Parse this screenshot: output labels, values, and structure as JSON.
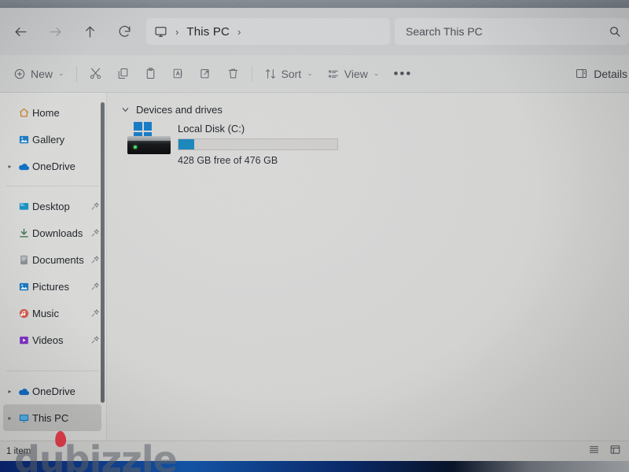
{
  "window": {
    "title": "This PC"
  },
  "nav": {
    "back_icon": "arrow-left-icon",
    "forward_icon": "arrow-right-icon",
    "up_icon": "arrow-up-icon",
    "refresh_icon": "refresh-icon"
  },
  "address": {
    "root_icon": "this-pc-monitor-icon",
    "separator": "›",
    "crumb": "This PC",
    "trailing_separator": "›"
  },
  "search": {
    "placeholder": "Search This PC",
    "icon": "search-icon"
  },
  "toolbar": {
    "new_label": "New",
    "new_icon": "plus-circle-icon",
    "new_chevron": "⌄",
    "cut_icon": "scissors-icon",
    "copy_icon": "copy-icon",
    "paste_icon": "clipboard-paste-icon",
    "rename_icon": "rename-icon",
    "share_icon": "share-icon",
    "delete_icon": "trash-icon",
    "sort_label": "Sort",
    "sort_icon": "sort-arrows-icon",
    "sort_chevron": "⌄",
    "view_label": "View",
    "view_icon": "view-list-icon",
    "view_chevron": "⌄",
    "more_label": "•••",
    "details_label": "Details",
    "details_icon": "details-pane-icon"
  },
  "sidebar": {
    "groups": [
      {
        "items": [
          {
            "label": "Home",
            "icon": "home-icon",
            "pinned": false,
            "chevron": false,
            "selected": false
          },
          {
            "label": "Gallery",
            "icon": "gallery-icon",
            "pinned": false,
            "chevron": false,
            "selected": false
          },
          {
            "label": "OneDrive",
            "icon": "onedrive-icon",
            "pinned": false,
            "chevron": true,
            "selected": false
          }
        ]
      },
      {
        "items": [
          {
            "label": "Desktop",
            "icon": "desktop-icon",
            "pinned": true,
            "chevron": false,
            "selected": false
          },
          {
            "label": "Downloads",
            "icon": "downloads-icon",
            "pinned": true,
            "chevron": false,
            "selected": false
          },
          {
            "label": "Documents",
            "icon": "documents-icon",
            "pinned": true,
            "chevron": false,
            "selected": false
          },
          {
            "label": "Pictures",
            "icon": "pictures-icon",
            "pinned": true,
            "chevron": false,
            "selected": false
          },
          {
            "label": "Music",
            "icon": "music-icon",
            "pinned": true,
            "chevron": false,
            "selected": false
          },
          {
            "label": "Videos",
            "icon": "videos-icon",
            "pinned": true,
            "chevron": false,
            "selected": false
          }
        ]
      },
      {
        "items": [
          {
            "label": "OneDrive",
            "icon": "onedrive-icon",
            "pinned": false,
            "chevron": true,
            "selected": false
          },
          {
            "label": "This PC",
            "icon": "this-pc-icon",
            "pinned": false,
            "chevron": true,
            "selected": true
          }
        ]
      }
    ],
    "pin_icon": "pin-icon",
    "scrollbar": "sidebar-scrollbar"
  },
  "content": {
    "group_title": "Devices and drives",
    "group_chevron": "⌄",
    "drives": [
      {
        "name": "Local Disk (C:)",
        "free_text": "428 GB free of 476 GB",
        "used_percent": 10,
        "bar_color": "#1b81b8",
        "icon": "windows-local-disk-icon"
      }
    ]
  },
  "status": {
    "item_count": "1 item",
    "list_view_icon": "list-view-icon",
    "details_view_icon": "details-view-icon"
  },
  "watermark": {
    "text": "dubizzle",
    "flame_color": "#e8283c"
  },
  "colors": {
    "window_bg": "#d6d6d5",
    "sidebar_bg": "#d9d9d8",
    "content_bg": "#d5d5d4",
    "accent_blue": "#1878c4",
    "selection": "#c2c2c1"
  }
}
